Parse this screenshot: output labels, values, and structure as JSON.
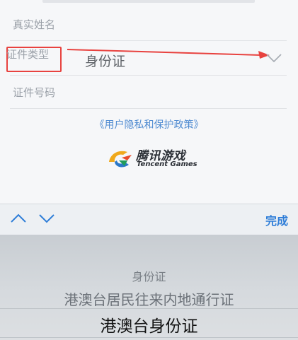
{
  "form": {
    "name_label": "真实姓名",
    "id_type_label": "证件类型",
    "id_type_value": "身份证",
    "id_number_label": "证件号码",
    "privacy_link": "《用户隐私和保护政策》",
    "logo_cn": "腾讯游戏",
    "logo_en": "Tencent Games"
  },
  "toolbar": {
    "done_label": "完成",
    "prev_icon": "chevron-up-icon",
    "next_icon": "chevron-down-icon"
  },
  "picker": {
    "options": [
      "身份证",
      "港澳台居民往来内地通行证",
      "港澳台身份证"
    ],
    "selected": "港澳台身份证"
  },
  "colors": {
    "annotation_red": "#e8423f",
    "link_blue": "#4f8bd1",
    "done_blue": "#2f7ed8"
  }
}
